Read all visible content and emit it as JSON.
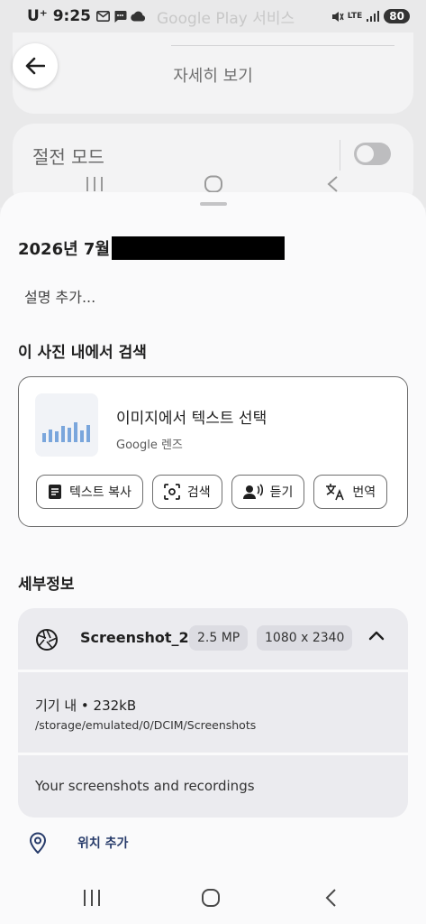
{
  "status_bar": {
    "time": "9:25",
    "carrier": "U⁺",
    "ghost_notification": "Google Play 서비스",
    "network": "LTE",
    "battery": "80"
  },
  "background": {
    "title": "자세히 보기",
    "power_mode_label": "절전 모드"
  },
  "sheet": {
    "date": "2026년 7월",
    "description_placeholder": "설명 추가...",
    "search_section_title": "이 사진 내에서 검색",
    "lens": {
      "title": "이미지에서 텍스트 선택",
      "subtitle": "Google 렌즈",
      "chips": [
        {
          "label": "텍스트 복사",
          "icon": "document-icon"
        },
        {
          "label": "검색",
          "icon": "lens-search-icon"
        },
        {
          "label": "듣기",
          "icon": "listen-icon"
        },
        {
          "label": "번역",
          "icon": "translate-icon"
        }
      ]
    },
    "details_section_title": "세부정보",
    "details": {
      "file_name": "Screenshot_2...",
      "megapixels": "2.5 MP",
      "resolution": "1080 x 2340",
      "storage_line": "기기 내 • 232kB",
      "path": "/storage/emulated/0/DCIM/Screenshots",
      "album": "Your screenshots and recordings"
    },
    "add_location": "위치 추가"
  },
  "colors": {
    "sheet_bg": "#fafafb",
    "detail_row_bg": "#ebebef",
    "location_accent": "#273b6a"
  }
}
